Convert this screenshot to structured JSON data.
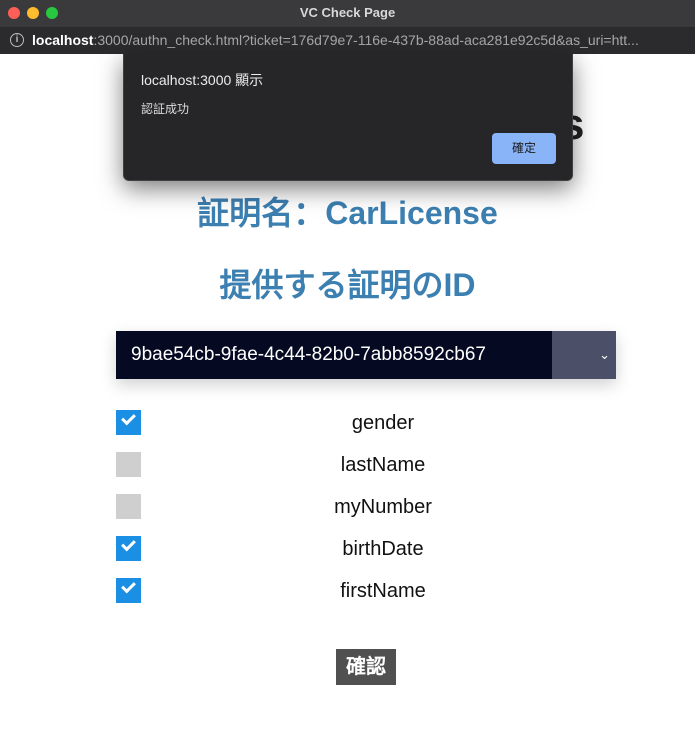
{
  "window": {
    "title": "VC Check Page"
  },
  "urlbar": {
    "host": "localhost",
    "rest": ":3000/authn_check.html?ticket=176d79e7-116e-437b-88ad-aca281e92c5d&as_uri=htt..."
  },
  "page": {
    "cert_heading": "証明名：CarLicense",
    "provide_heading": "提供する証明のID",
    "selected_id": "9bae54cb-9fae-4c44-82b0-7abb8592cb67",
    "attributes": [
      {
        "label": "gender",
        "checked": true
      },
      {
        "label": "lastName",
        "checked": false
      },
      {
        "label": "myNumber",
        "checked": false
      },
      {
        "label": "birthDate",
        "checked": true
      },
      {
        "label": "firstName",
        "checked": true
      }
    ],
    "confirm_label": "確認"
  },
  "dialog": {
    "title": "localhost:3000 顯示",
    "message": "認証成功",
    "ok_label": "確定"
  },
  "colors": {
    "heading": "#3c7fb1",
    "select_bg": "#050a22",
    "checkbox_checked": "#1a8fe3",
    "checkbox_unchecked": "#cfcfcf",
    "dialog_button": "#8ab4f8"
  }
}
